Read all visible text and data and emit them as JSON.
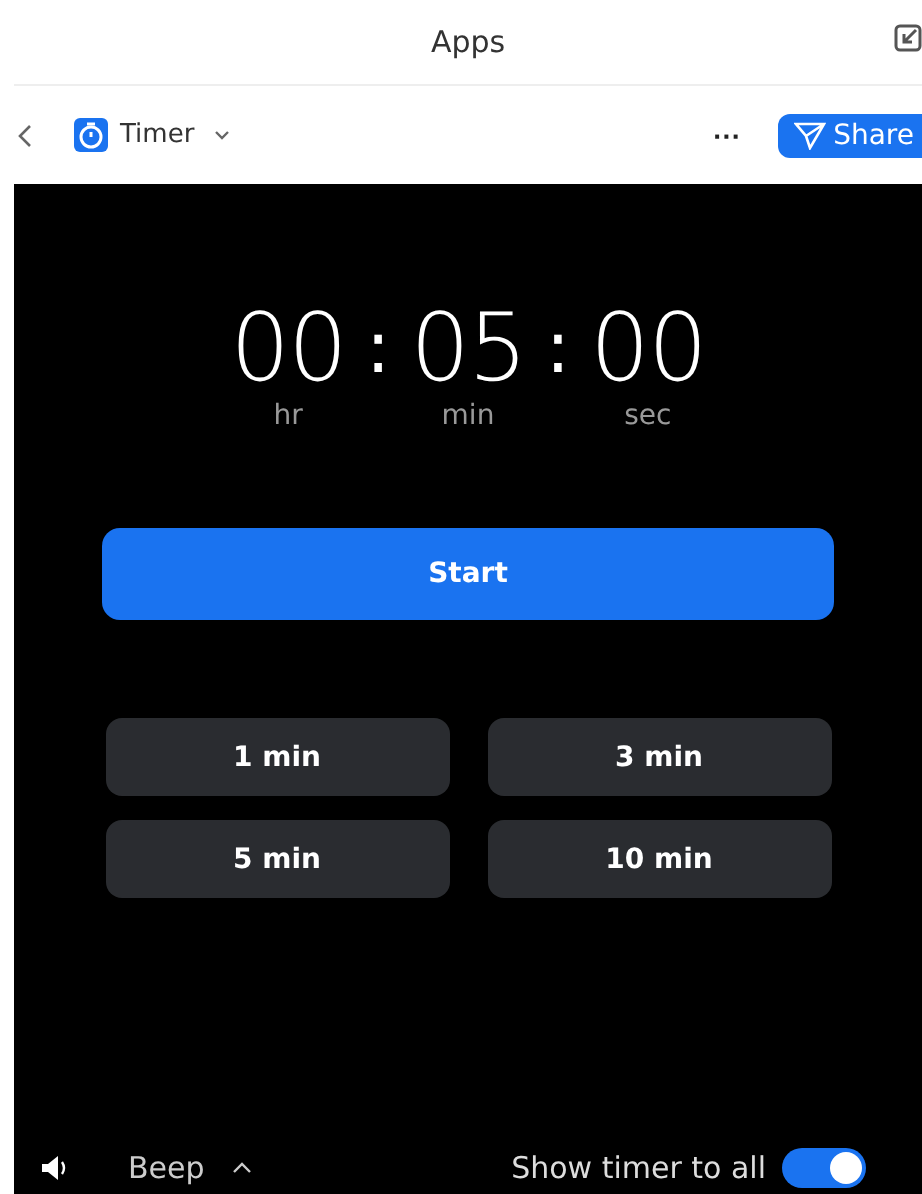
{
  "header": {
    "title": "Apps"
  },
  "nav": {
    "app_name": "Timer",
    "more": "···",
    "share": "Share"
  },
  "timer": {
    "units": [
      {
        "value": "00",
        "label": "hr"
      },
      {
        "value": "05",
        "label": "min"
      },
      {
        "value": "00",
        "label": "sec"
      }
    ],
    "separator": ":"
  },
  "start": "Start",
  "presets": [
    "1 min",
    "3 min",
    "5 min",
    "10 min"
  ],
  "footer": {
    "sound": "Beep",
    "show_label": "Show timer to all",
    "show_on": true
  }
}
